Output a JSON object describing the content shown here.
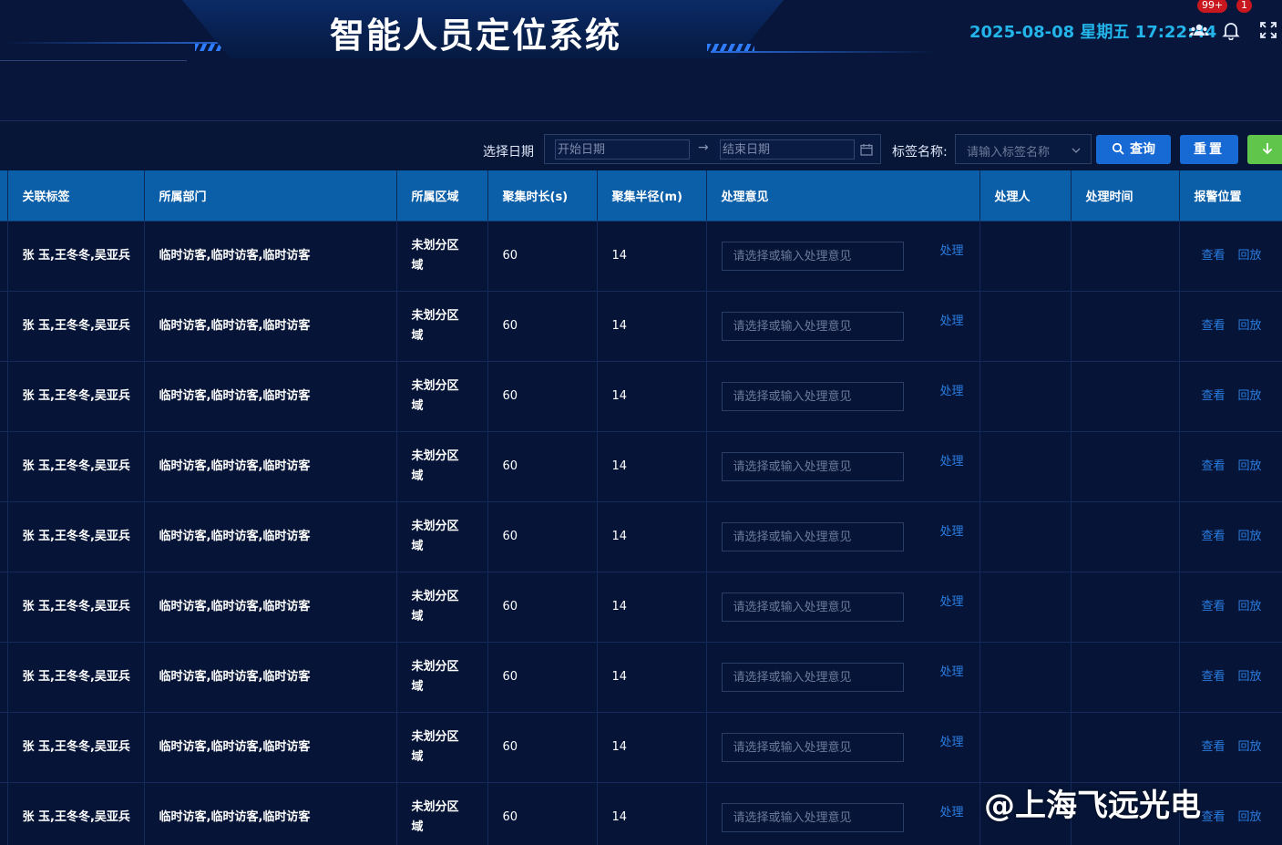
{
  "header": {
    "title": "智能人员定位系统",
    "datetime": "2025-08-08 星期五 17:22:44",
    "people_badge": "99+",
    "bell_badge": "1"
  },
  "filter": {
    "date_label": "选择日期",
    "start_placeholder": "开始日期",
    "end_placeholder": "结束日期",
    "range_separator": "→",
    "tag_label": "标签名称:",
    "tag_placeholder": "请输入标签名称",
    "query_label": "查询",
    "reset_label": "重置"
  },
  "table": {
    "columns": [
      "关联标签",
      "所属部门",
      "所属区域",
      "聚集时长(s)",
      "聚集半径(m)",
      "处理意见",
      "处理人",
      "处理时间",
      "报警位置"
    ],
    "opinion_placeholder": "请选择或输入处理意见",
    "process_label": "处理",
    "view_label": "查看",
    "playback_label": "回放",
    "rows": [
      {
        "tags": "张 玉,王冬冬,吴亚兵",
        "dept": "临时访客,临时访客,临时访客",
        "area": "未划分区域",
        "duration": "60",
        "radius": "14",
        "handler": "",
        "time": ""
      },
      {
        "tags": "张 玉,王冬冬,吴亚兵",
        "dept": "临时访客,临时访客,临时访客",
        "area": "未划分区域",
        "duration": "60",
        "radius": "14",
        "handler": "",
        "time": ""
      },
      {
        "tags": "张 玉,王冬冬,吴亚兵",
        "dept": "临时访客,临时访客,临时访客",
        "area": "未划分区域",
        "duration": "60",
        "radius": "14",
        "handler": "",
        "time": ""
      },
      {
        "tags": "张 玉,王冬冬,吴亚兵",
        "dept": "临时访客,临时访客,临时访客",
        "area": "未划分区域",
        "duration": "60",
        "radius": "14",
        "handler": "",
        "time": ""
      },
      {
        "tags": "张 玉,王冬冬,吴亚兵",
        "dept": "临时访客,临时访客,临时访客",
        "area": "未划分区域",
        "duration": "60",
        "radius": "14",
        "handler": "",
        "time": ""
      },
      {
        "tags": "张 玉,王冬冬,吴亚兵",
        "dept": "临时访客,临时访客,临时访客",
        "area": "未划分区域",
        "duration": "60",
        "radius": "14",
        "handler": "",
        "time": ""
      },
      {
        "tags": "张 玉,王冬冬,吴亚兵",
        "dept": "临时访客,临时访客,临时访客",
        "area": "未划分区域",
        "duration": "60",
        "radius": "14",
        "handler": "",
        "time": ""
      },
      {
        "tags": "张 玉,王冬冬,吴亚兵",
        "dept": "临时访客,临时访客,临时访客",
        "area": "未划分区域",
        "duration": "60",
        "radius": "14",
        "handler": "",
        "time": ""
      },
      {
        "tags": "张 玉,王冬冬,吴亚兵",
        "dept": "临时访客,临时访客,临时访客",
        "area": "未划分区域",
        "duration": "60",
        "radius": "14",
        "handler": "",
        "time": ""
      }
    ]
  },
  "watermark": "@上海飞远光电",
  "colors": {
    "header_row": "#0b5ea8",
    "link": "#2a7de1",
    "datetime": "#23b4ea",
    "export": "#5fc54b",
    "badge": "#c8171e"
  }
}
